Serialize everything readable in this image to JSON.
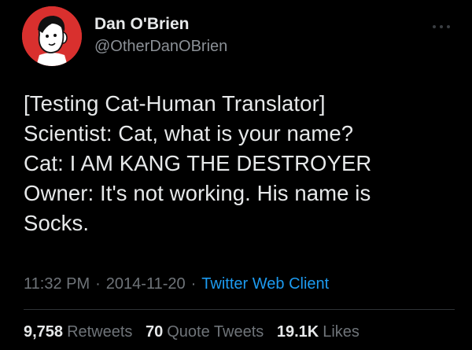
{
  "author": {
    "display_name": "Dan O'Brien",
    "handle": "@OtherDanOBrien",
    "avatar_icon": "cartoon-face-avatar",
    "avatar_color": "#d9302e"
  },
  "tweet": {
    "lines": [
      "[Testing Cat-Human Translator]",
      "Scientist: Cat, what is your name?",
      "Cat: I AM KANG THE DESTROYER",
      "Owner: It's not working. His name is",
      "Socks."
    ]
  },
  "meta": {
    "time": "11:32 PM",
    "separator": "·",
    "date": "2014-11-20",
    "source": "Twitter Web Client"
  },
  "stats": {
    "retweets_count": "9,758",
    "retweets_label": "Retweets",
    "quotes_count": "70",
    "quotes_label": "Quote Tweets",
    "likes_count": "19.1K",
    "likes_label": "Likes"
  },
  "colors": {
    "background": "#000000",
    "text": "#e7e9ea",
    "secondary": "#6f7479",
    "link": "#1d9bf0"
  },
  "icons": {
    "more": "more-horizontal-icon"
  }
}
